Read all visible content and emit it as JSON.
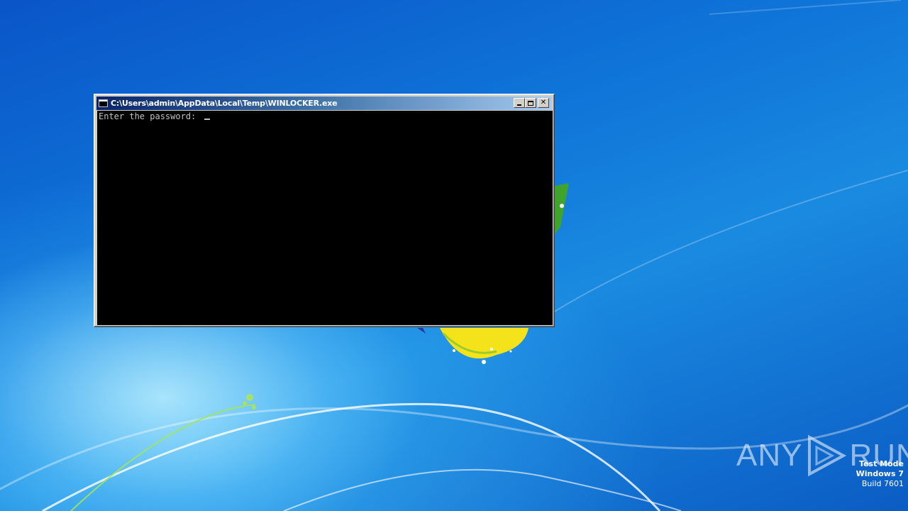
{
  "console": {
    "title": "C:\\Users\\admin\\AppData\\Local\\Temp\\WINLOCKER.exe",
    "prompt": "Enter the password: ",
    "minimize_label": "",
    "maximize_label": "",
    "close_label": "✕"
  },
  "watermark": {
    "logo_left": "ANY",
    "logo_right": "RUN"
  },
  "windows_info": {
    "mode": "Test Mode",
    "os": "Windows 7",
    "build": "Build 7601"
  }
}
